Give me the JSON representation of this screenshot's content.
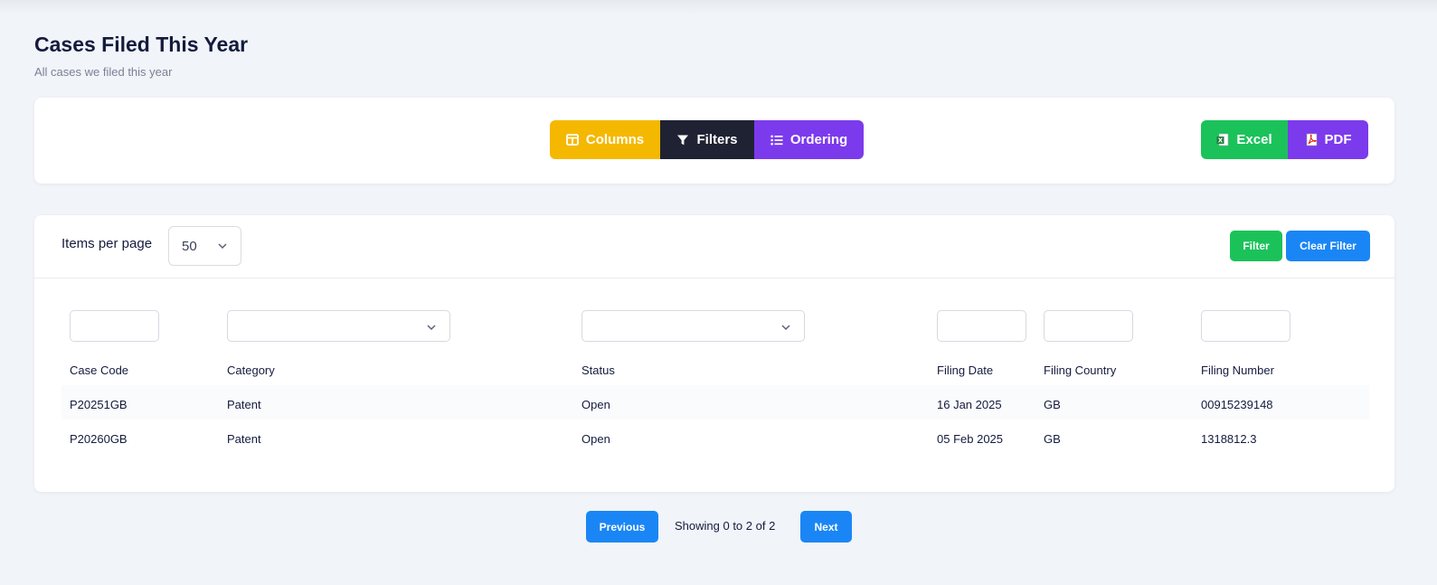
{
  "page": {
    "title": "Cases Filed This Year",
    "subtitle": "All cases we filed this year"
  },
  "toolbar": {
    "columns_label": "Columns",
    "filters_label": "Filters",
    "ordering_label": "Ordering",
    "excel_label": "Excel",
    "pdf_label": "PDF",
    "colors": {
      "columns": "#f5b800",
      "filters": "#1f2233",
      "ordering": "#7c3aed",
      "excel": "#1bc25a",
      "pdf": "#7c3aed"
    }
  },
  "table_controls": {
    "items_per_page_label": "Items per page",
    "items_per_page_value": "50",
    "filter_label": "Filter",
    "clear_filter_label": "Clear Filter"
  },
  "table": {
    "columns": [
      "Case Code",
      "Category",
      "Status",
      "Filing Date",
      "Filing Country",
      "Filing Number"
    ],
    "rows": [
      [
        "P20251GB",
        "Patent",
        "Open",
        "16 Jan 2025",
        "GB",
        "00915239148"
      ],
      [
        "P20260GB",
        "Patent",
        "Open",
        "05 Feb 2025",
        "GB",
        "1318812.3"
      ]
    ]
  },
  "pagination": {
    "previous_label": "Previous",
    "next_label": "Next",
    "showing_text": "Showing 0 to 2 of 2"
  }
}
